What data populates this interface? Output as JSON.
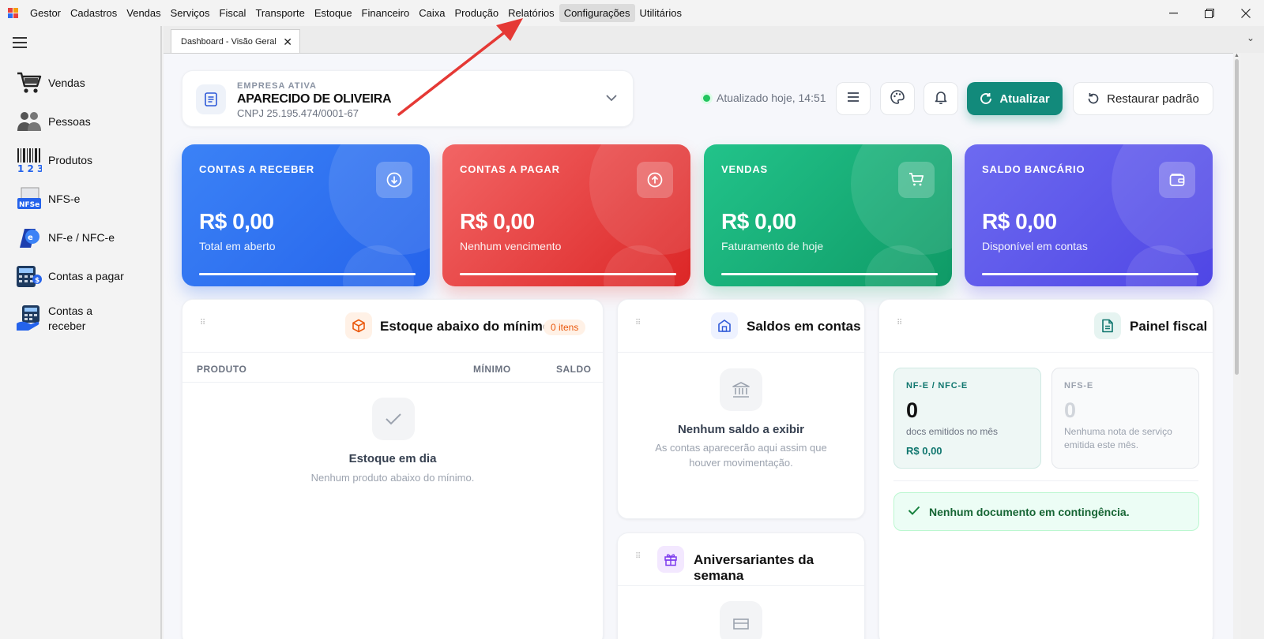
{
  "menubar": {
    "items": [
      "Gestor",
      "Cadastros",
      "Vendas",
      "Serviços",
      "Fiscal",
      "Transporte",
      "Estoque",
      "Financeiro",
      "Caixa",
      "Produção",
      "Relatórios",
      "Configurações",
      "Utilitários"
    ]
  },
  "sidebar": {
    "items": [
      {
        "label": "Vendas",
        "icon": "shopping-cart-icon"
      },
      {
        "label": "Pessoas",
        "icon": "people-icon"
      },
      {
        "label": "Produtos",
        "icon": "barcode-icon"
      },
      {
        "label": "NFS-e",
        "icon": "nfse-icon"
      },
      {
        "label": "NF-e / NFC-e",
        "icon": "nfe-icon"
      },
      {
        "label": "Contas a pagar",
        "icon": "calculator-icon"
      },
      {
        "label": "Contas a\nreceber",
        "icon": "receivables-icon"
      }
    ]
  },
  "tabs": [
    {
      "label": "Dashboard - Visão Geral"
    }
  ],
  "company": {
    "label": "EMPRESA ATIVA",
    "name": "APARECIDO DE OLIVEIRA",
    "cnpj": "CNPJ 25.195.474/0001-67"
  },
  "status": {
    "updated": "Atualizado hoje, 14:51"
  },
  "actions": {
    "refresh": "Atualizar",
    "restore": "Restaurar padrão"
  },
  "kpis": [
    {
      "title": "CONTAS A RECEBER",
      "value": "R$ 0,00",
      "sub": "Total em aberto",
      "icon": "arrow-down-circle-icon",
      "color": "#2f6cf0"
    },
    {
      "title": "CONTAS A PAGAR",
      "value": "R$ 0,00",
      "sub": "Nenhum vencimento",
      "icon": "arrow-up-circle-icon",
      "color": "#e8413e"
    },
    {
      "title": "VENDAS",
      "value": "R$ 0,00",
      "sub": "Faturamento de hoje",
      "icon": "cart-icon",
      "color": "#17b57a"
    },
    {
      "title": "SALDO BANCÁRIO",
      "value": "R$ 0,00",
      "sub": "Disponível em contas",
      "icon": "wallet-icon",
      "color": "#5b55ec"
    }
  ],
  "estoque": {
    "title": "Estoque abaixo do mínimo",
    "badge": "0 itens",
    "columns": [
      "PRODUTO",
      "MÍNIMO",
      "SALDO"
    ],
    "empty_title": "Estoque em dia",
    "empty_sub": "Nenhum produto abaixo do mínimo."
  },
  "saldos": {
    "title": "Saldos em contas",
    "empty_title": "Nenhum saldo a exibir",
    "empty_sub": "As contas aparecerão aqui assim que houver movimentação."
  },
  "aniversariantes": {
    "title": "Aniversariantes da semana"
  },
  "fiscal": {
    "title": "Painel fiscal",
    "nfe": {
      "label": "NF-E / NFC-E",
      "count": "0",
      "desc": "docs emitidos no mês",
      "value": "R$ 0,00"
    },
    "nfse": {
      "label": "NFS-E",
      "count": "0",
      "desc": "Nenhuma nota de serviço emitida este mês."
    },
    "contingency": "Nenhum documento em contingência."
  }
}
